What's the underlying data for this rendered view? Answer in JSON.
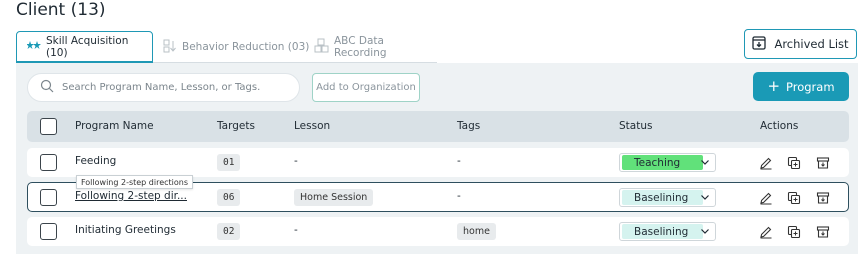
{
  "page": {
    "title": "Client (13)"
  },
  "tabs": [
    {
      "label": "Skill Acquisition (10)",
      "active": true,
      "icon": "skill-stars-icon"
    },
    {
      "label": "Behavior Reduction (03)",
      "active": false,
      "icon": "behavior-blocks-icon"
    },
    {
      "label": "ABC Data Recording",
      "active": false,
      "icon": "abc-blocks-icon"
    }
  ],
  "archived": {
    "label": "Archived List",
    "icon": "archive-tray-icon"
  },
  "toolbar": {
    "search_placeholder": "Search Program Name, Lesson, or Tags.",
    "add_org_label": "Add to Organization",
    "program_label": "Program",
    "program_icon": "plus-icon"
  },
  "table": {
    "headers": {
      "name": "Program Name",
      "targets": "Targets",
      "lesson": "Lesson",
      "tags": "Tags",
      "status": "Status",
      "actions": "Actions"
    },
    "rows": [
      {
        "name": "Feeding",
        "targets": "01",
        "lesson": "-",
        "tags": "-",
        "status": "Teaching"
      },
      {
        "name": "Following 2-step dir...",
        "targets": "06",
        "lesson": "Home Session",
        "tags": "-",
        "status": "Baselining"
      },
      {
        "name": "Initiating Greetings",
        "targets": "02",
        "lesson": "-",
        "tags": "home",
        "status": "Baselining"
      }
    ]
  },
  "tooltip": {
    "text": "Following 2-step directions"
  },
  "colors": {
    "accent": "#1a9ab6",
    "teaching": "#61e17a",
    "baselining": "#d5f3ef",
    "panel_bg": "#eef2f4",
    "header_bg": "#d9e1e6"
  }
}
